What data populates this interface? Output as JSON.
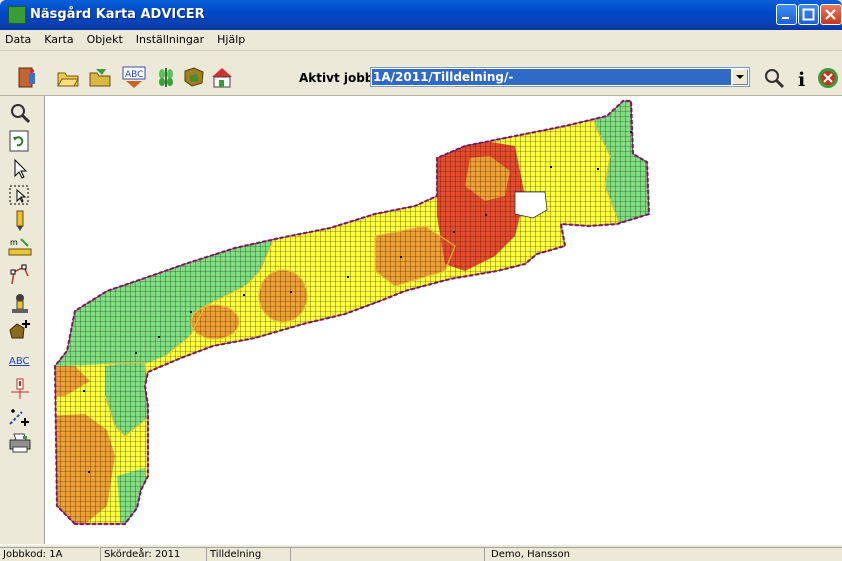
{
  "window": {
    "title": "Näsgård Karta ADVICER"
  },
  "menu": [
    "Data",
    "Karta",
    "Objekt",
    "Inställningar",
    "Hjälp"
  ],
  "toolbar": {
    "aktivt_label": "Aktivt jobb",
    "aktivt_value": "1A/2011/Tilldelning/-",
    "abc_label": "ABC"
  },
  "lefttools": {
    "abc_label": "ABC",
    "ruler_label": "m"
  },
  "status": [
    "Jobbkod: 1A",
    "Skördeår: 2011",
    "Tilldelning",
    "",
    "Demo, Hansson"
  ],
  "colors": {
    "titlebar": "#0a5fd8",
    "zone_green": "#7fe07f",
    "zone_yellow": "#ffff3a",
    "zone_orange": "#f0a030",
    "zone_red": "#e84a2a"
  }
}
